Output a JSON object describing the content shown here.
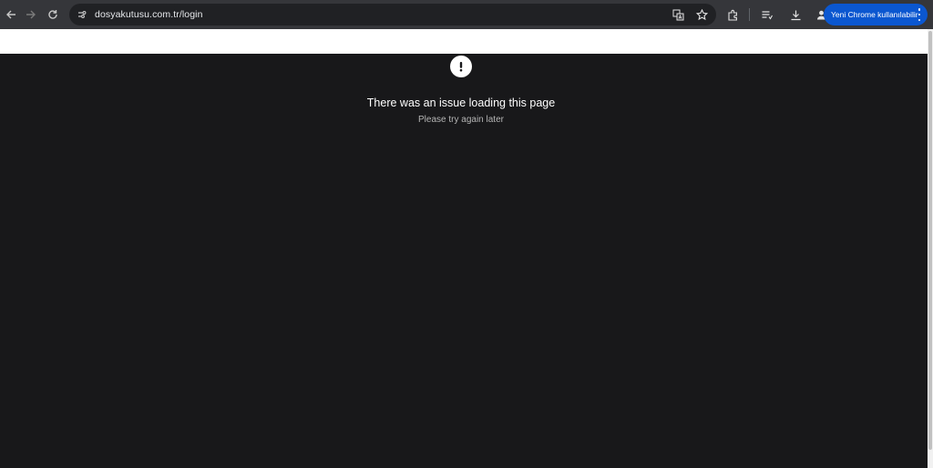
{
  "browser": {
    "url": "dosyakutusu.com.tr/login",
    "update_label": "Yeni Chrome kullanılabilir",
    "icons": [
      "back-icon",
      "forward-icon",
      "reload-icon",
      "site-info-icon",
      "translate-icon",
      "bookmark-star-icon",
      "extensions-icon",
      "reading-list-icon",
      "download-icon",
      "profile-icon",
      "kebab-menu-icon"
    ],
    "accent_color": "#0b57d0"
  },
  "page": {
    "error_title": "There was an issue loading this page",
    "error_subtitle": "Please try again later",
    "error_icon": "exclamation-icon",
    "background_color": "#18181a"
  }
}
